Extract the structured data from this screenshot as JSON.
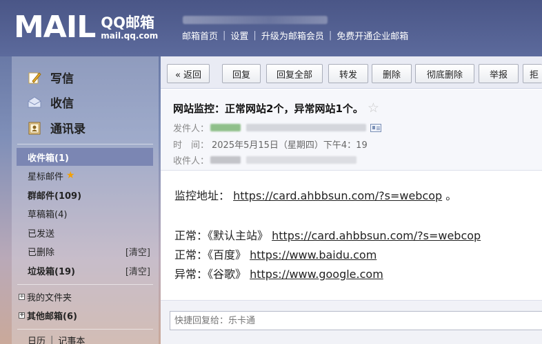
{
  "header": {
    "logo_main": "MAIL",
    "logo_cn": "QQ邮箱",
    "logo_url": "mail.qq.com",
    "nav": [
      "邮箱首页",
      "设置",
      "升级为邮箱会员",
      "免费开通企业邮箱"
    ]
  },
  "sidebar": {
    "main_buttons": [
      {
        "label": "写信",
        "icon": "pencil-icon"
      },
      {
        "label": "收信",
        "icon": "inbox-icon"
      },
      {
        "label": "通讯录",
        "icon": "contacts-icon"
      }
    ],
    "folders": [
      {
        "label": "收件箱(1)"
      },
      {
        "label": "星标邮件"
      },
      {
        "label": "群邮件(109)"
      },
      {
        "label": "草稿箱(4)"
      },
      {
        "label": "已发送"
      },
      {
        "label": "已删除",
        "action": "[清空]"
      },
      {
        "label": "垃圾箱(19)",
        "action": "[清空]"
      }
    ],
    "groups": [
      {
        "label": "我的文件夹"
      },
      {
        "label": "其他邮箱(6)"
      }
    ],
    "bottom": [
      "日历",
      "记事本"
    ]
  },
  "toolbar": {
    "buttons": [
      "« 返回",
      "回复",
      "回复全部",
      "转发",
      "删除",
      "彻底删除",
      "举报",
      "拒"
    ]
  },
  "email": {
    "subject": "网站监控：正常网站2个，异常网站1个。",
    "from_label": "发件人：",
    "time_label": "时　间：",
    "time_value": "2025年5月15日（星期四）下午4：19",
    "to_label": "收件人：",
    "body": {
      "line1_label": "监控地址：",
      "line1_link": "https://card.ahbbsun.com/?s=webcop",
      "line1_end": "。",
      "line2_label": "正常：《默认主站》",
      "line2_link": "https://card.ahbbsun.com/?s=webcop",
      "line3_label": "正常：《百度》",
      "line3_link": "https://www.baidu.com",
      "line4_label": "异常：《谷歌》",
      "line4_link": "https://www.google.com"
    }
  },
  "quick_reply": {
    "placeholder": "快捷回复给：乐卡通"
  }
}
